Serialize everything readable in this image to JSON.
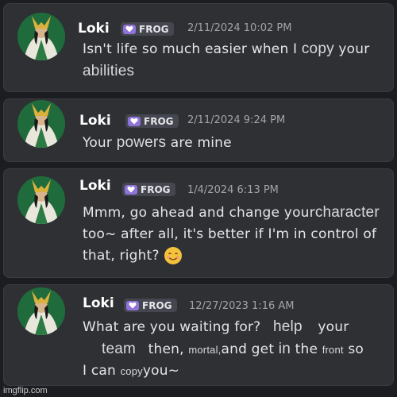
{
  "messages": [
    {
      "user": "Loki",
      "badge": "FROG",
      "timestamp": "2/11/2024 10:02 PM",
      "line1_a": "Isn't life so much easier when I",
      "line1_b": "copy",
      "line1_c": "your",
      "line2_a": "abilities"
    },
    {
      "user": "Loki",
      "badge": "FROG",
      "timestamp": "2/11/2024 9:24 PM",
      "line1_a": "Your",
      "line1_b": "powers",
      "line1_c": "are mine"
    },
    {
      "user": "Loki",
      "badge": "FROG",
      "timestamp": "1/4/2024 6:13 PM",
      "line1_a": "Mmm, go ahead and change your",
      "line1_b": "character",
      "line2_a": "too~ after all, it's better if I'm in control of",
      "line3_a": "that, right?"
    },
    {
      "user": "Loki",
      "badge": "FROG",
      "timestamp": "12/27/2023 1:16 AM",
      "line1_a": "What are you waiting for?",
      "line1_b": "help",
      "line1_c": "your",
      "line2_a": "team",
      "line2_b": "then,",
      "line2_c": "mortal,",
      "line2_d": "and get",
      "line2_e": "in",
      "line2_f": "the",
      "line2_g": "front",
      "line2_h": "so",
      "line3_a": "I can",
      "line3_b": "copy",
      "line3_c": "you~"
    }
  ],
  "watermark": "imgflip.com",
  "colors": {
    "background": "#1c1d20",
    "panel": "#2e3034",
    "badge_heart": "#8f73d8",
    "timestamp": "#a2a4aa"
  }
}
